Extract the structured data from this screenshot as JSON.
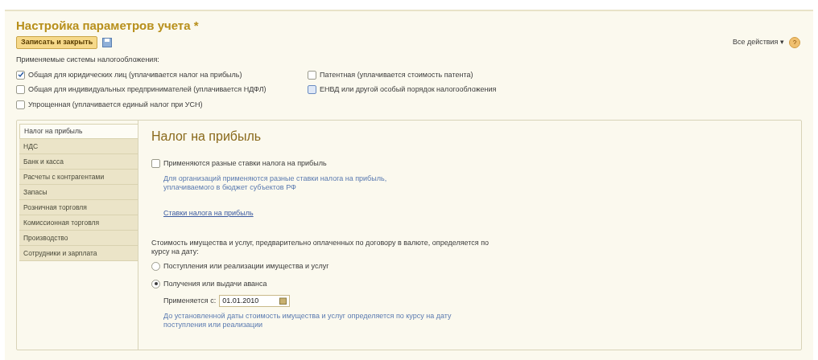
{
  "window": {
    "title": "Настройка параметров учета *"
  },
  "toolbar": {
    "save_close": "Записать и закрыть",
    "all_actions": "Все действия ▾"
  },
  "tax_systems": {
    "label": "Применяемые системы налогообложения:",
    "options": [
      {
        "label": "Общая для юридических лиц (уплачивается налог на прибыль)",
        "checked": true
      },
      {
        "label": "Патентная (уплачивается стоимость патента)",
        "checked": false
      },
      {
        "label": "Общая для индивидуальных предпринимателей (уплачивается НДФЛ)",
        "checked": false
      },
      {
        "label": "ЕНВД или другой особый порядок налогообложения",
        "checked": false
      },
      {
        "label": "Упрощенная (уплачивается единый налог при УСН)",
        "checked": false
      }
    ]
  },
  "tabs": [
    {
      "label": "Налог на прибыль",
      "selected": true
    },
    {
      "label": "НДС",
      "selected": false
    },
    {
      "label": "Банк и касса",
      "selected": false
    },
    {
      "label": "Расчеты с контрагентами",
      "selected": false
    },
    {
      "label": "Запасы",
      "selected": false
    },
    {
      "label": "Розничная торговля",
      "selected": false
    },
    {
      "label": "Комиссионная торговля",
      "selected": false
    },
    {
      "label": "Производство",
      "selected": false
    },
    {
      "label": "Сотрудники и зарплата",
      "selected": false
    }
  ],
  "panel": {
    "heading": "Налог на прибыль",
    "different_rates": {
      "label": "Применяются разные ставки налога на прибыль",
      "checked": false
    },
    "rates_hint": "Для организаций применяются разные ставки налога на прибыль, уплачиваемого в бюджет субъектов РФ",
    "rates_link": "Ставки налога на прибыль",
    "valuation_label": "Стоимость имущества и услуг, предварительно оплаченных по договору в валюте, определяется по курсу на дату:",
    "valuation_options": [
      {
        "label": "Поступления или реализации имущества и услуг",
        "selected": false
      },
      {
        "label": "Получения или выдачи аванса",
        "selected": true
      }
    ],
    "applies_from": {
      "label": "Применяется с:",
      "value": "01.01.2010"
    },
    "applies_hint": "До установленной даты стоимость имущества и услуг определяется по курсу на дату поступления или реализации"
  }
}
